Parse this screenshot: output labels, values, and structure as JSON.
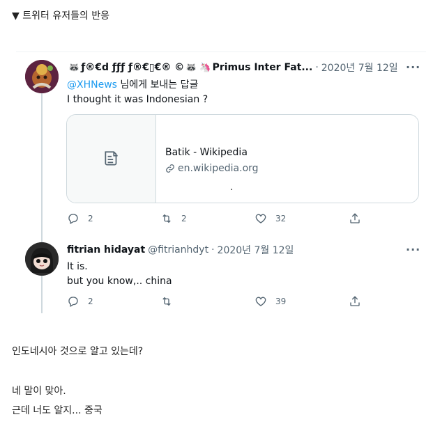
{
  "section": {
    "marker": "▼",
    "title": "트위터 유저들의 반응"
  },
  "tweet1": {
    "raccoon_emoji": "🦝",
    "display_name_a": "ƒ®€d ƒƒƒ ƒ®€▯€® ©",
    "raccoon_emoji_2": "🦝",
    "unicorn_emoji": "🦄",
    "display_name_b": "Primus Inter Fat...",
    "separator": "·",
    "date": "2020년 7월 12일",
    "reply_mention": "@XHNews",
    "reply_suffix": " 님에게 보내는 답글",
    "text": "I thought it was Indonesian ?",
    "card": {
      "title": "Batik - Wikipedia",
      "domain": "en.wikipedia.org",
      "dot": "."
    },
    "stats": {
      "replies": "2",
      "retweets": "2",
      "likes": "32"
    }
  },
  "tweet2": {
    "display_name": "fitrian hidayat",
    "handle": "@fitrianhdyt",
    "separator": "·",
    "date": "2020년 7월 12일",
    "line1": "It is.",
    "line2": "but you know,.. china",
    "stats": {
      "replies": "2",
      "retweets": "",
      "likes": "39"
    }
  },
  "translation": {
    "line1": "인도네시아 것으로 알고 있는데?",
    "line2": "네 말이 맞아.",
    "line3": "근데 너도 알지... 중국"
  },
  "icons": {
    "more": "more-dots-icon",
    "reply": "speech-bubble-icon",
    "retweet": "retweet-arrows-icon",
    "like": "heart-icon",
    "share": "share-upload-icon",
    "card_thumb": "document-icon",
    "link": "link-icon"
  },
  "colors": {
    "link_blue": "#1d9bf0",
    "muted": "#536471",
    "border": "#cfd9de"
  }
}
